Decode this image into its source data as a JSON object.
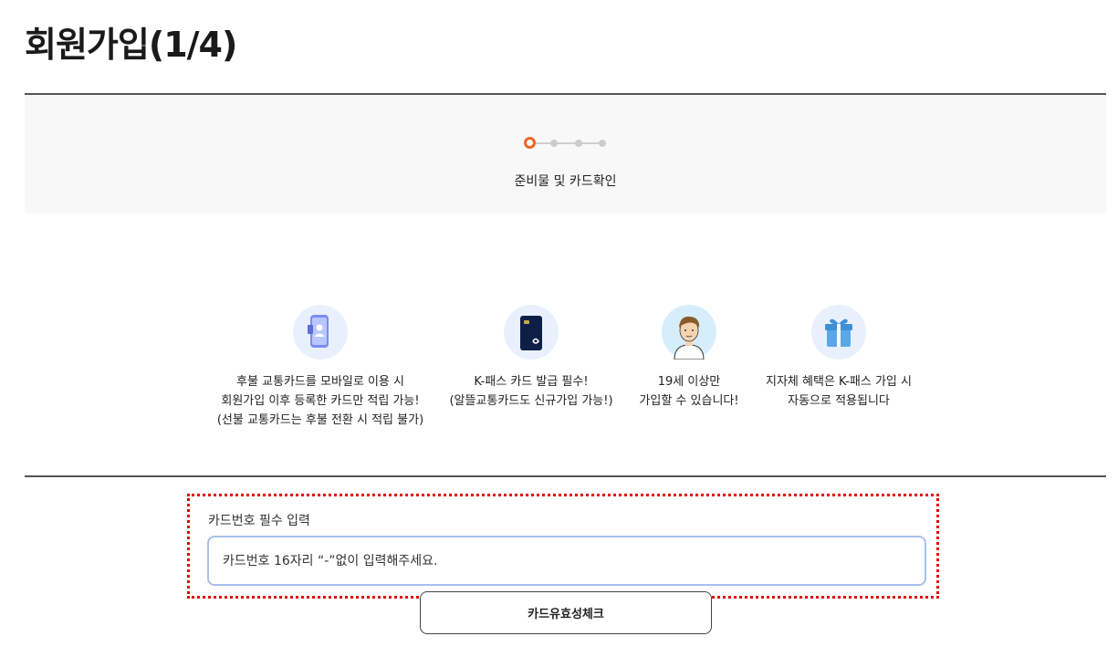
{
  "page": {
    "title": "회원가입(1/4)"
  },
  "stepper": {
    "current_step": 1,
    "total_steps": 4,
    "current_label": "준비물 및 카드확인"
  },
  "features": [
    {
      "icon": "phone-card-icon",
      "lines": [
        "후불 교통카드를 모바일로 이용 시",
        "회원가입 이후 등록한 카드만 적립 가능!",
        "(선불 교통카드는 후불 전환 시 적립 불가)"
      ]
    },
    {
      "icon": "k-pass-card-icon",
      "lines": [
        "K-패스 카드 발급 필수!",
        "(알뜰교통카드도 신규가입 가능!)"
      ]
    },
    {
      "icon": "person-avatar-icon",
      "lines": [
        "19세 이상만",
        "가입할 수 있습니다!"
      ]
    },
    {
      "icon": "gift-icon",
      "lines": [
        "지자체 혜택은 K-패스 가입 시",
        "자동으로 적용됩니다"
      ]
    }
  ],
  "card_form": {
    "label": "카드번호 필수 입력",
    "placeholder": "카드번호 16자리 “-”없이 입력해주세요.",
    "value": ""
  },
  "check_button": {
    "label": "카드유효성체크"
  },
  "colors": {
    "accent": "#f06428",
    "input_border": "#a8c0ea",
    "highlight_box": "#e60000",
    "icon_bg": "#e9f0fd",
    "panel_bg": "#f8f8f8"
  }
}
